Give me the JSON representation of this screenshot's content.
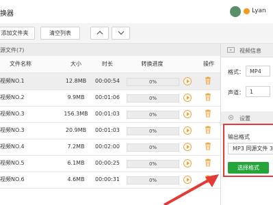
{
  "app": {
    "title": "换器"
  },
  "user": {
    "name": "Lyan"
  },
  "toolbar": {
    "add_folder": "添加文件夹",
    "clear_list": "清空列表",
    "move_up": "︿",
    "move_down": "﹀"
  },
  "source": {
    "header": "源文件(7)"
  },
  "table": {
    "columns": {
      "name": "文件名称",
      "size": "大小",
      "duration": "时长",
      "progress": "转换进度",
      "actions": "操作"
    },
    "rows": [
      {
        "name": "视频NO.1",
        "size": "12.8MB",
        "duration": "00:00:54",
        "progress": "0%"
      },
      {
        "name": "视频NO.2",
        "size": "9.9MB",
        "duration": "00:01:06",
        "progress": "0%"
      },
      {
        "name": "视频NO.3",
        "size": "156.3MB",
        "duration": "00:01:03",
        "progress": "0%"
      },
      {
        "name": "视频NO.3",
        "size": "20.9MB",
        "duration": "00:01:03",
        "progress": "0%"
      },
      {
        "name": "视频NO.4",
        "size": "7.2MB",
        "duration": "00:02:00",
        "progress": "0%"
      },
      {
        "name": "视频NO.5",
        "size": "6.1MB",
        "duration": "00:00:25",
        "progress": "0%"
      },
      {
        "name": "视频NO.6",
        "size": "4.6MB",
        "duration": "00:00:31",
        "progress": "0%"
      }
    ]
  },
  "video_info": {
    "header": "视频信息",
    "format_label": "格式：",
    "format_value": "MP4",
    "channel_label": "声道：",
    "channel_value": "1"
  },
  "settings": {
    "header": "设置",
    "output_label": "输出格式",
    "output_value": "MP3 同源文件 3",
    "choose_button": "选择格式"
  },
  "colors": {
    "accent_green": "#23a53a",
    "highlight_red": "#e53935",
    "action_orange": "#f0a33a"
  }
}
